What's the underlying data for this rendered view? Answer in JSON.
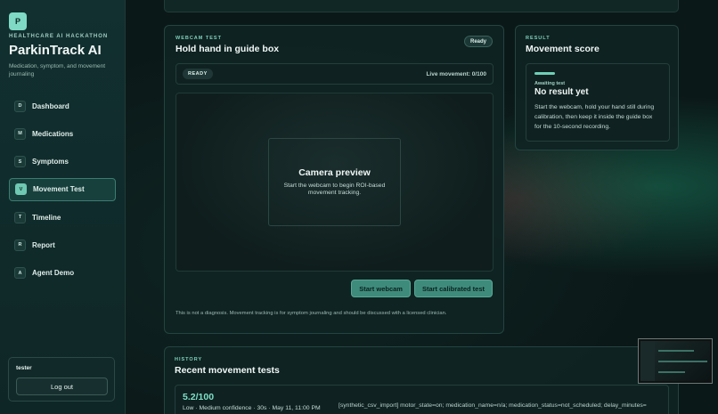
{
  "sidebar": {
    "logo_letter": "P",
    "hackathon_label": "HEALTHCARE AI HACKATHON",
    "app_name": "ParkinTrack AI",
    "tagline": "Medication, symptom, and movement journaling",
    "items": [
      {
        "badge": "D",
        "label": "Dashboard"
      },
      {
        "badge": "M",
        "label": "Medications"
      },
      {
        "badge": "S",
        "label": "Symptoms"
      },
      {
        "badge": "V",
        "label": "Movement Test"
      },
      {
        "badge": "T",
        "label": "Timeline"
      },
      {
        "badge": "R",
        "label": "Report"
      },
      {
        "badge": "A",
        "label": "Agent Demo"
      }
    ],
    "active_index": 3,
    "user": {
      "name": "tester",
      "logout_label": "Log out"
    }
  },
  "webcam": {
    "eyebrow": "WEBCAM TEST",
    "title": "Hold hand in guide box",
    "ready_chip": "Ready",
    "status_chip": "READY",
    "live_movement": "Live movement: 0/100",
    "preview_title": "Camera preview",
    "preview_subtitle": "Start the webcam to begin ROI-based movement tracking.",
    "start_webcam_label": "Start webcam",
    "start_calibrated_label": "Start calibrated test",
    "disclaimer": "This is not a diagnosis. Movement tracking is for symptom journaling and should be discussed with a licensed clinician."
  },
  "result": {
    "eyebrow": "RESULT",
    "title": "Movement score",
    "awaiting": "Awaiting test",
    "no_result": "No result yet",
    "description": "Start the webcam, hold your hand still during calibration, then keep it inside the guide box for the 10-second recording."
  },
  "history": {
    "eyebrow": "HISTORY",
    "title": "Recent movement tests",
    "entries": [
      {
        "score": "5.2/100",
        "meta": "Low · Medium confidence · 30s · May 11, 11:00 PM",
        "log": "[synthetic_csv_import] motor_state=on; medication_name=n/a; medication_status=not_scheduled; delay_minutes="
      }
    ]
  },
  "colors": {
    "accent": "#6fd0b8",
    "background": "#0b1818",
    "panel": "#0f2423"
  }
}
